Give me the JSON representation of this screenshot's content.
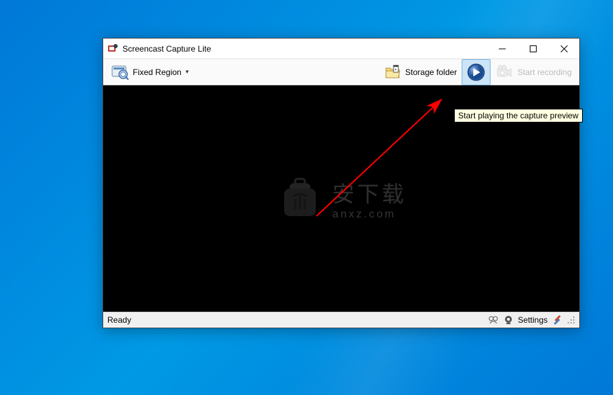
{
  "window": {
    "title": "Screencast Capture Lite"
  },
  "toolbar": {
    "region_label": "Fixed Region",
    "storage_label": "Storage folder",
    "record_label": "Start recording"
  },
  "tooltip": {
    "text": "Start playing the capture preview"
  },
  "watermark": {
    "cn": "安下载",
    "url": "anxz.com"
  },
  "statusbar": {
    "status": "Ready",
    "settings_label": "Settings"
  }
}
